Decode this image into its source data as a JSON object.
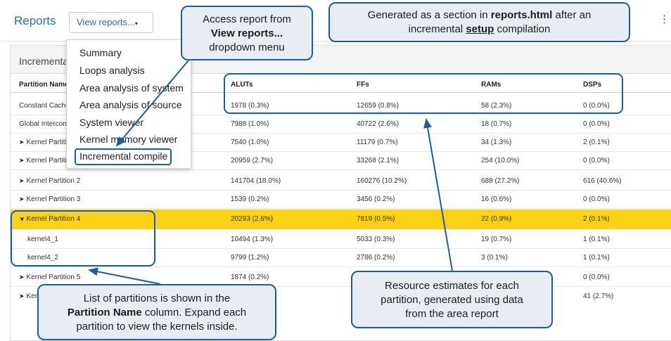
{
  "header": {
    "title": "Reports",
    "view_reports_label": "View reports...",
    "caret": "▾",
    "more": "⋮"
  },
  "panel": {
    "title": "Incremental compile"
  },
  "table": {
    "headers": {
      "name": "Partition Name",
      "aluts": "ALUTs",
      "ffs": "FFs",
      "rams": "RAMs",
      "dsps": "DSPs"
    },
    "rows": [
      {
        "name": "Constant Cache Interconnect",
        "aluts": "1978 (0.3%)",
        "ffs": "12659 (0.8%)",
        "rams": "58 (2.3%)",
        "dsps": "0 (0.0%)"
      },
      {
        "name": "Global Interconnect",
        "aluts": "7988 (1.0%)",
        "ffs": "40722 (2.6%)",
        "rams": "18 (0.7%)",
        "dsps": "0 (0.0%)"
      },
      {
        "name": "Kernel Partition 0",
        "aluts": "7540 (1.0%)",
        "ffs": "11179 (0.7%)",
        "rams": "34 (1.3%)",
        "dsps": "2 (0.1%)"
      },
      {
        "name": "Kernel Partition 1",
        "aluts": "20959 (2.7%)",
        "ffs": "33268 (2.1%)",
        "rams": "254 (10.0%)",
        "dsps": "0 (0.0%)"
      },
      {
        "name": "Kernel Partition 2",
        "aluts": "141704 (18.0%)",
        "ffs": "160276 (10.2%)",
        "rams": "688 (27.2%)",
        "dsps": "616 (40.6%)"
      },
      {
        "name": "Kernel Partition 3",
        "aluts": "1539 (0.2%)",
        "ffs": "3456 (0.2%)",
        "rams": "16 (0.6%)",
        "dsps": "0 (0.0%)"
      },
      {
        "name": "Kernel Partition 4",
        "aluts": "20293 (2.6%)",
        "ffs": "7819 (0.5%)",
        "rams": "22 (0.9%)",
        "dsps": "2 (0.1%)"
      },
      {
        "name": "kernel4_1",
        "aluts": "10494 (1.3%)",
        "ffs": "5033 (0.3%)",
        "rams": "19 (0.7%)",
        "dsps": "1 (0.1%)"
      },
      {
        "name": "kernel4_2",
        "aluts": "9799 (1.2%)",
        "ffs": "2786 (0.2%)",
        "rams": "3 (0.1%)",
        "dsps": "1 (0.1%)"
      },
      {
        "name": "Kernel Partition 5",
        "aluts": "1874 (0.2%)",
        "ffs": "",
        "rams": "",
        "dsps": "0 (0.0%)"
      },
      {
        "name": "Kernel Partition 6",
        "aluts": "",
        "ffs": "",
        "rams": "",
        "dsps": "41 (2.7%)"
      }
    ]
  },
  "dropdown": {
    "items": [
      "Summary",
      "Loops analysis",
      "Area analysis of system",
      "Area analysis of source",
      "System viewer",
      "Kernel memory viewer",
      "Incremental compile"
    ]
  },
  "callouts": {
    "access": {
      "line1": "Access report from",
      "line2_bold": "View reports...",
      "line3": "dropdown menu"
    },
    "generated": {
      "l1_a": "Generated as a section in ",
      "l1_bold": "reports.html",
      "l1_b": " after an",
      "l2_a": "incremental ",
      "l2_bold": "setup",
      "l2_b": " compilation"
    },
    "partitions": {
      "l1": "List of partitions is shown in the",
      "l2_bold": "Partition Name",
      "l2_b": " column. Expand each",
      "l3": "partition to view the kernels inside."
    },
    "resources": {
      "l1": "Resource estimates for each",
      "l2": "partition, generated using data",
      "l3": "from the area report"
    }
  },
  "icons": {
    "collapsed": "chevron-right-icon",
    "expanded": "chevron-down-icon"
  },
  "colors": {
    "accent": "#1b5e9c",
    "highlight_row": "#fcd116",
    "link": "#2a6db5",
    "callout_fill": "#e9edf3"
  }
}
